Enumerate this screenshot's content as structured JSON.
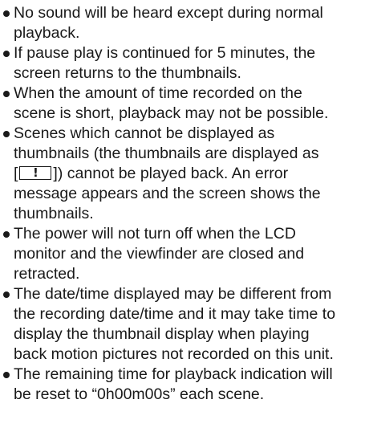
{
  "notes": [
    {
      "lines": [
        "No sound will be heard except during normal",
        "playback."
      ]
    },
    {
      "lines": [
        "If pause play is continued for 5 minutes, the",
        "screen returns to the thumbnails."
      ]
    },
    {
      "lines": [
        "When the amount of time recorded on the",
        "scene is short, playback may not be possible."
      ]
    },
    {
      "lines": [
        "Scenes which cannot be displayed as",
        "thumbnails (the thumbnails are displayed as"
      ],
      "icon_prefix": "[",
      "icon_glyph": "!",
      "icon_suffix": "]) cannot be played back. An error",
      "tail_lines": [
        "message appears and the screen shows the",
        "thumbnails."
      ]
    },
    {
      "lines": [
        "The power will not turn off when the LCD",
        "monitor and the viewfinder are closed and",
        "retracted."
      ]
    },
    {
      "lines": [
        "The date/time displayed may be different from",
        "the recording date/time and it may take time to",
        "display the thumbnail display when playing",
        "back motion pictures not recorded on this unit."
      ]
    },
    {
      "lines": [
        "The remaining time for playback indication will",
        "be reset to “0h00m00s” each scene."
      ]
    }
  ]
}
